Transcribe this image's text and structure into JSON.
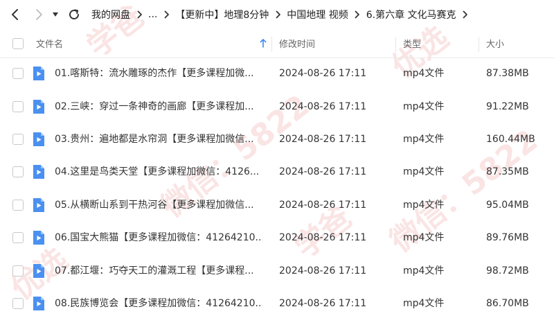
{
  "breadcrumbs": [
    {
      "label": "我的网盘"
    },
    {
      "label": "..."
    },
    {
      "label": "【更新中】地理8分钟"
    },
    {
      "label": "中国地理 视频"
    },
    {
      "label": "6.第六章 文化马赛克"
    }
  ],
  "columns": {
    "name": "文件名",
    "time": "修改时间",
    "type": "类型",
    "size": "大小"
  },
  "files": [
    {
      "name": "01.喀斯特：流水雕琢的杰作【更多课程加微...",
      "time": "2024-08-26 17:11",
      "type": "mp4文件",
      "size": "87.38MB"
    },
    {
      "name": "02.三峡：穿过一条神奇的画廊【更多课程加...",
      "time": "2024-08-26 17:11",
      "type": "mp4文件",
      "size": "91.22MB"
    },
    {
      "name": "03.贵州：遍地都是水帘洞【更多课程加微信...",
      "time": "2024-08-26 17:11",
      "type": "mp4文件",
      "size": "160.44MB"
    },
    {
      "name": "04.这里是鸟类天堂【更多课程加微信：4126...",
      "time": "2024-08-26 17:11",
      "type": "mp4文件",
      "size": "87.35MB"
    },
    {
      "name": "05.从横断山系到干热河谷【更多课程加微信...",
      "time": "2024-08-26 17:11",
      "type": "mp4文件",
      "size": "95.04MB"
    },
    {
      "name": "06.国宝大熊猫【更多课程加微信：41264210...",
      "time": "2024-08-26 17:11",
      "type": "mp4文件",
      "size": "89.76MB"
    },
    {
      "name": "07.都江堰：巧夺天工的灌溉工程【更多课程...",
      "time": "2024-08-26 17:11",
      "type": "mp4文件",
      "size": "98.72MB"
    },
    {
      "name": "08.民族博览会【更多课程加微信：41264210...",
      "time": "2024-08-26 17:11",
      "type": "mp4文件",
      "size": "86.70MB"
    }
  ],
  "watermarks": [
    "学爸",
    "微信：5822",
    "优选",
    "微信：5822",
    "学爸",
    "优选"
  ],
  "colors": {
    "accent": "#3d8af7",
    "file_icon": "#4a90f0"
  },
  "icons": {
    "back": "chevron-left-icon",
    "forward": "chevron-right-icon",
    "dropdown": "caret-down-icon",
    "refresh": "refresh-icon",
    "sort": "sort-arrow-up-icon",
    "file": "video-file-icon"
  }
}
